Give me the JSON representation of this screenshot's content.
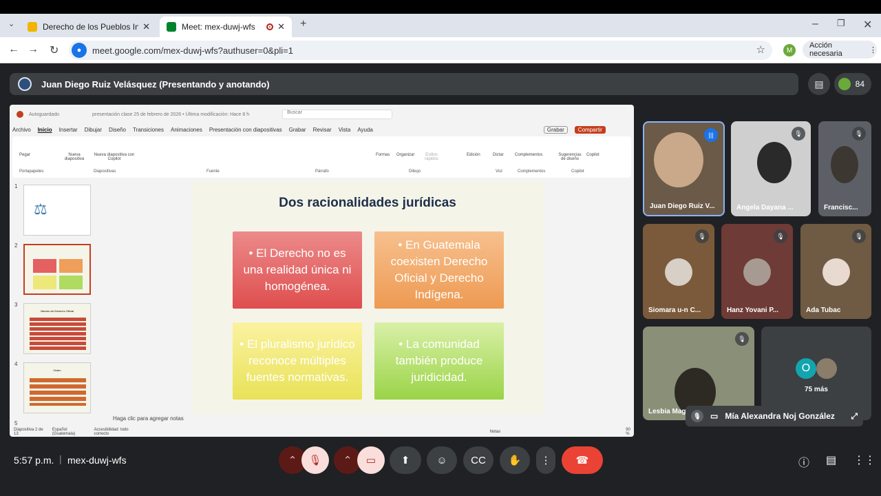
{
  "browser": {
    "tabs": [
      {
        "title": "Derecho de los Pueblos Indígen",
        "active": false
      },
      {
        "title": "Meet: mex-duwj-wfs",
        "active": true
      }
    ],
    "url": "meet.google.com/mex-duwj-wfs?authuser=0&pli=1",
    "profile_initial": "M",
    "action_label": "Acción necesaria"
  },
  "meet": {
    "presenter_banner": "Juan Diego Ruiz Velásquez (Presentando y anotando)",
    "participant_count": "84",
    "time": "5:57 p.m.",
    "meeting_code": "mex-duwj-wfs",
    "participants": [
      {
        "name": "Juan Diego Ruiz V..."
      },
      {
        "name": "Angela Dayana ..."
      },
      {
        "name": "Francisc..."
      },
      {
        "name": "Siomara u-n C..."
      },
      {
        "name": "Hanz Yovani P..."
      },
      {
        "name": "Ada Tubac"
      },
      {
        "name": "Lesbia Mag"
      }
    ],
    "more_label": "75 más",
    "more_initial": "O",
    "self_name": "Mía Alexandra Noj González"
  },
  "powerpoint": {
    "autosave": "Autoguardado",
    "doc_title": "presentación clase 25 de febrero de 2026 • Última modificación: Hace 8 h",
    "search": "Buscar",
    "menu": [
      "Archivo",
      "Inicio",
      "Insertar",
      "Dibujar",
      "Diseño",
      "Transiciones",
      "Animaciones",
      "Presentación con diapositivas",
      "Grabar",
      "Revisar",
      "Vista",
      "Ayuda"
    ],
    "record_btn": "Grabar",
    "share_btn": "Compartir",
    "ribbon_groups": [
      "Portapapeles",
      "Diapositivas",
      "Fuente",
      "Párrafo",
      "Dibujo",
      "Voz",
      "Complementos",
      "Copilot"
    ],
    "ribbon_buttons": [
      "Pegar",
      "Nueva diapositiva",
      "Nueva diapositiva con Copilot",
      "Formas",
      "Organizar",
      "Estilos rápidos",
      "Edición",
      "Dictar",
      "Complementos",
      "Sugerencias de diseño",
      "Copilot"
    ],
    "slide_title": "Dos racionalidades jurídicas",
    "boxes": [
      "• El Derecho no es una realidad única ni homogénea.",
      "• En Guatemala coexisten Derecho Oficial y Derecho Indígena.",
      "• El pluralismo jurídico reconoce múltiples fuentes normativas.",
      "• La comunidad también produce juridicidad."
    ],
    "notes_placeholder": "Haga clic para agregar notas",
    "status": {
      "slide": "Diapositiva 2 de 13",
      "language": "Español (Guatemala)",
      "accessibility": "Accesibilidad: todo correcto",
      "notes": "Notas",
      "zoom": "90 %"
    },
    "thumb_numbers": [
      "1",
      "2",
      "3",
      "4",
      "5"
    ],
    "thumb3_title": "Valores del Derecho Oficial",
    "thumb4_title": "Orden"
  }
}
